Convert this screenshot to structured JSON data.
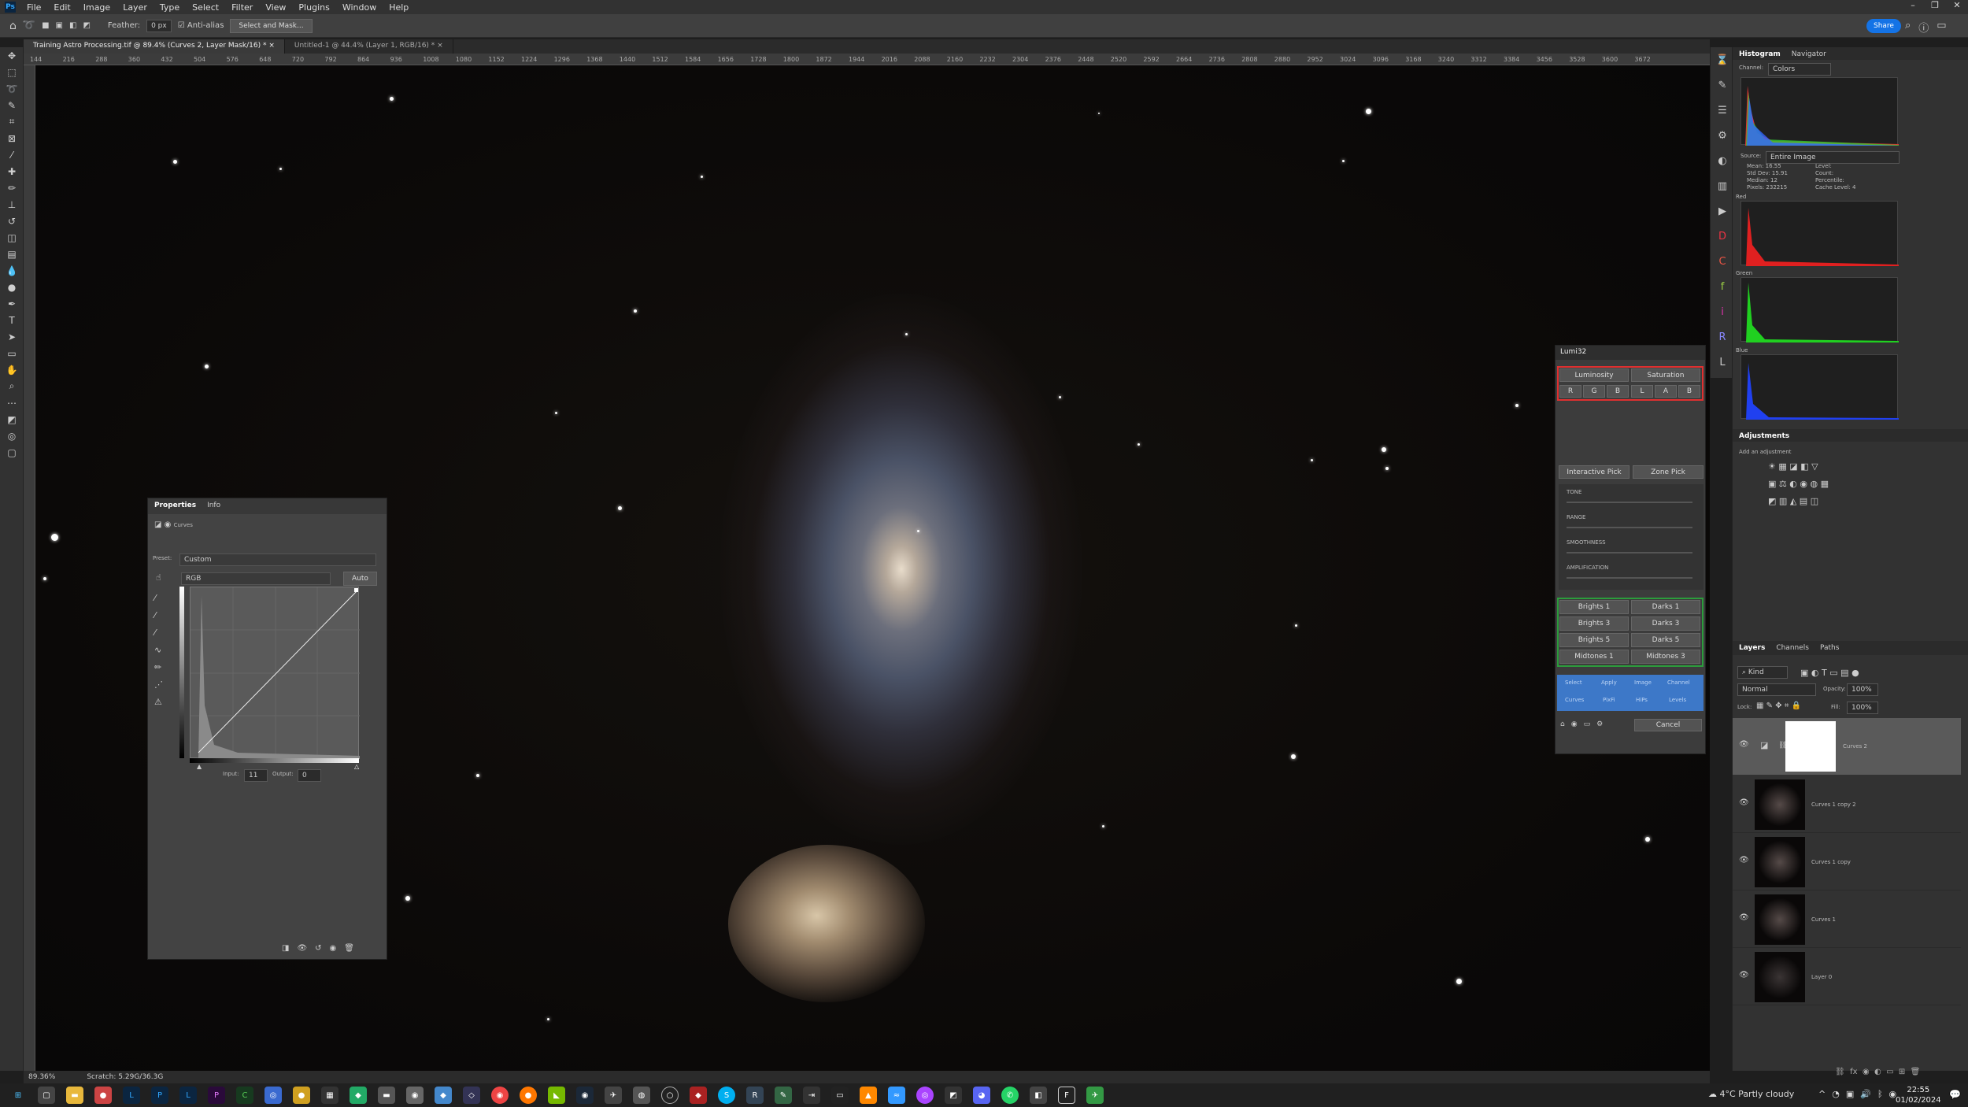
{
  "menu": [
    "File",
    "Edit",
    "Image",
    "Layer",
    "Type",
    "Select",
    "Filter",
    "View",
    "Plugins",
    "Window",
    "Help"
  ],
  "options": {
    "feather_label": "Feather:",
    "feather_value": "0 px",
    "antialias": "Anti-alias",
    "select_mask": "Select and Mask...",
    "share": "Share"
  },
  "tabs": [
    "Training Astro Processing.tif @ 89.4% (Curves 2, Layer Mask/16) *",
    "Untitled-1 @ 44.4% (Layer 1, RGB/16) *"
  ],
  "ruler": [
    "144",
    "216",
    "288",
    "360",
    "432",
    "504",
    "576",
    "648",
    "720",
    "792",
    "864",
    "936",
    "1008",
    "1080",
    "1152",
    "1224",
    "1296",
    "1368",
    "1440",
    "1512",
    "1584",
    "1656",
    "1728",
    "1800",
    "1872",
    "1944",
    "2016",
    "2088",
    "2160",
    "2232",
    "2304",
    "2376",
    "2448",
    "2520",
    "2592",
    "2664",
    "2736",
    "2808",
    "2880",
    "2952",
    "3024",
    "3096",
    "3168",
    "3240",
    "3312",
    "3384",
    "3456",
    "3528",
    "3600",
    "3672"
  ],
  "status": {
    "zoom": "89.36%",
    "scratch": "Scratch: 5.29G/36.3G"
  },
  "histogram": {
    "tab1": "Histogram",
    "tab2": "Navigator",
    "channel_label": "Channel:",
    "channel": "Colors",
    "source_label": "Source:",
    "source": "Entire Image",
    "mean": "Mean: 16.55",
    "stddev": "Std Dev: 15.91",
    "median": "Median: 12",
    "pixels": "Pixels: 232215",
    "level": "Level:",
    "count": "Count:",
    "percentile": "Percentile:",
    "cache": "Cache Level: 4",
    "red": "Red",
    "green": "Green",
    "blue": "Blue"
  },
  "adjustments": {
    "title": "Adjustments",
    "add": "Add an adjustment"
  },
  "layers": {
    "tab1": "Layers",
    "tab2": "Channels",
    "tab3": "Paths",
    "kind": "Kind",
    "blend": "Normal",
    "opacity_label": "Opacity:",
    "opacity": "100%",
    "lock_label": "Lock:",
    "fill_label": "Fill:",
    "fill": "100%",
    "items": [
      "Curves 2",
      "Curves 1 copy 2",
      "Curves 1 copy",
      "Curves 1",
      "Layer 0"
    ]
  },
  "properties": {
    "tab1": "Properties",
    "tab2": "Info",
    "type": "Curves",
    "preset_label": "Preset:",
    "preset": "Custom",
    "channel": "RGB",
    "auto": "Auto",
    "input_label": "Input:",
    "input": "11",
    "output_label": "Output:",
    "output": "0"
  },
  "lumi": {
    "title": "Lumi32",
    "luminosity": "Luminosity",
    "saturation": "Saturation",
    "rgb": [
      "R",
      "G",
      "B",
      "L",
      "A",
      "B"
    ],
    "interactive": "Interactive Pick",
    "zone": "Zone Pick",
    "sliders": [
      "TONE",
      "RANGE",
      "SMOOTHNESS",
      "AMPLIFICATION"
    ],
    "masks": [
      "Brights 1",
      "Darks 1",
      "Brights 3",
      "Darks 3",
      "Brights 5",
      "Darks 5",
      "Midtones 1",
      "Midtones 3"
    ],
    "actions": [
      "Select",
      "Apply",
      "Image",
      "Channel",
      "Curves",
      "PixFi",
      "HiPs",
      "Levels"
    ],
    "cancel": "Cancel"
  },
  "taskbar": {
    "weather": "4°C Partly cloudy",
    "time": "22:55",
    "date": "01/02/2024"
  }
}
